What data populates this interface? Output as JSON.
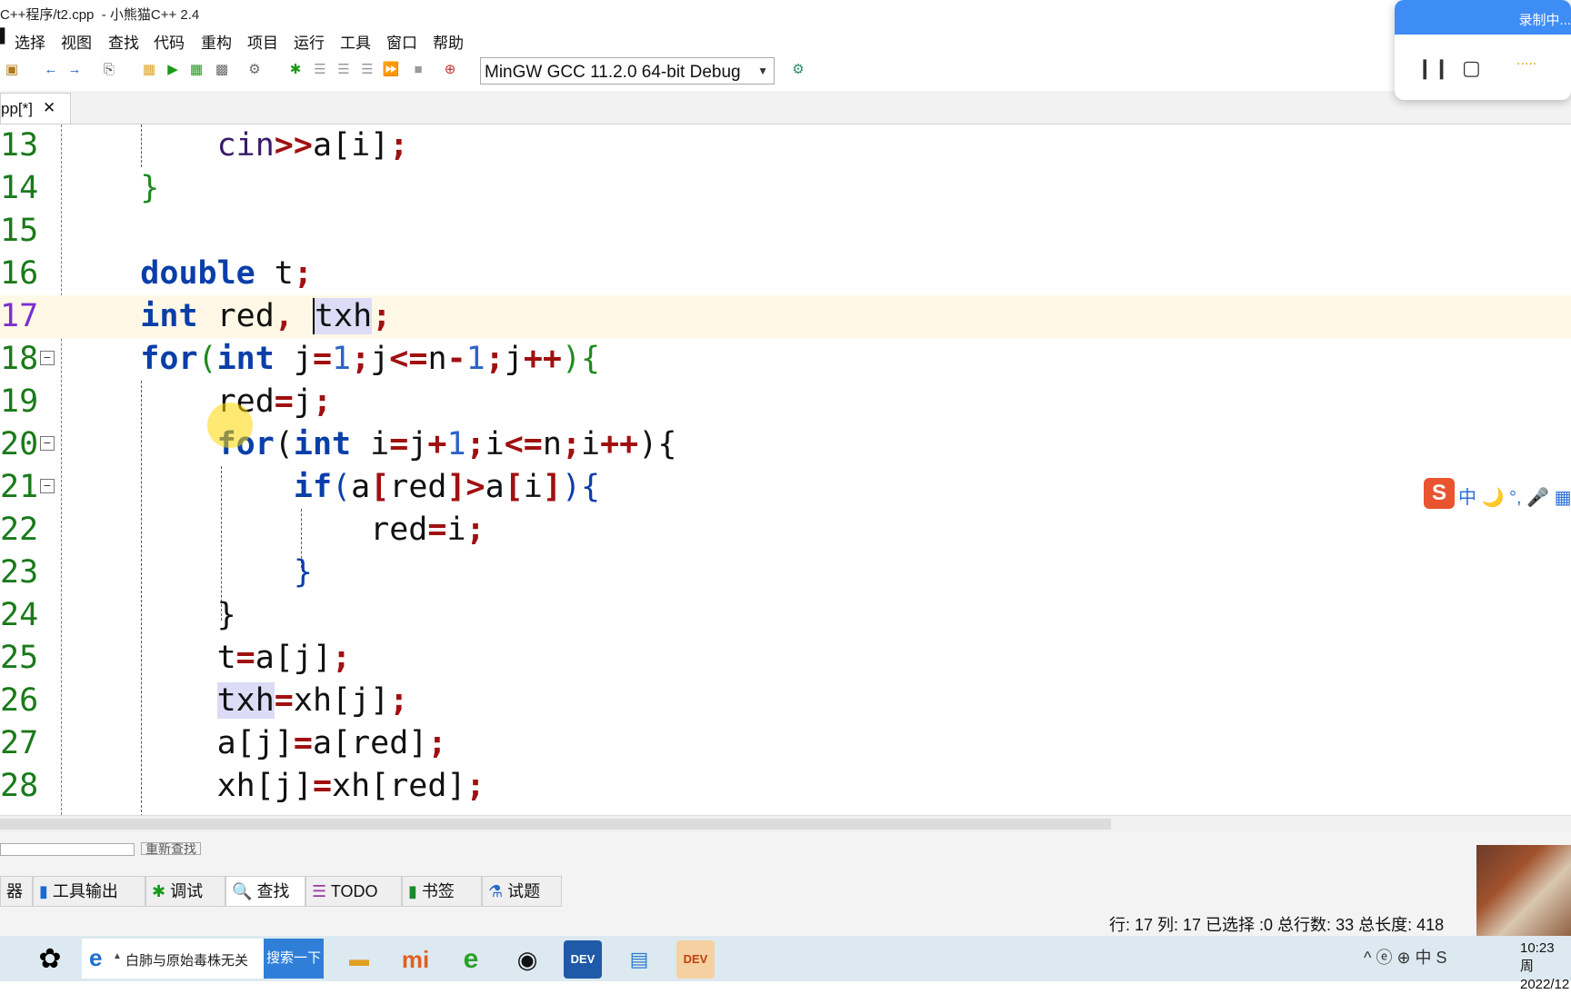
{
  "window_title": "C++程序/t2.cpp  - 小熊猫C++ 2.4",
  "menu": [
    "选择",
    "视图",
    "查找",
    "代码",
    "重构",
    "项目",
    "运行",
    "工具",
    "窗口",
    "帮助"
  ],
  "compiler_select": "MinGW GCC 11.2.0 64-bit Debug",
  "tab": {
    "label": "pp[*]",
    "close": "✕"
  },
  "recorder": {
    "title": "录制中..."
  },
  "ime_status": "中 🌙 °, 🎤 ▦",
  "code_lines": [
    {
      "n": "13",
      "text": "cin>>a[i];"
    },
    {
      "n": "14",
      "text": "}"
    },
    {
      "n": "15",
      "text": ""
    },
    {
      "n": "16",
      "text": "double t;"
    },
    {
      "n": "17",
      "text": "int red, txh;"
    },
    {
      "n": "18",
      "text": "for(int j=1;j<=n-1;j++){"
    },
    {
      "n": "19",
      "text": "red=j;"
    },
    {
      "n": "20",
      "text": "for(int i=j+1;i<=n;i++){"
    },
    {
      "n": "21",
      "text": "if(a[red]>a[i]){"
    },
    {
      "n": "22",
      "text": "red=i;"
    },
    {
      "n": "23",
      "text": "}"
    },
    {
      "n": "24",
      "text": "}"
    },
    {
      "n": "25",
      "text": "t=a[j];"
    },
    {
      "n": "26",
      "text": "txh=xh[j];"
    },
    {
      "n": "27",
      "text": "a[j]=a[red];"
    },
    {
      "n": "28",
      "text": "xh[j]=xh[red];"
    }
  ],
  "research_button": "重新查找",
  "bottom_tabs": [
    "器",
    "工具输出",
    "调试",
    "查找",
    "TODO",
    "书签",
    "试题"
  ],
  "status_bar": "行: 17 列: 17 已选择 :0 总行数: 33 总长度: 418",
  "taskbar": {
    "search_text": "白肺与原始毒株无关",
    "search_button": "搜索一下",
    "tray": "^ ⓔ ⊕ 中 S",
    "time": "10:23 周",
    "date": "2022/12"
  }
}
